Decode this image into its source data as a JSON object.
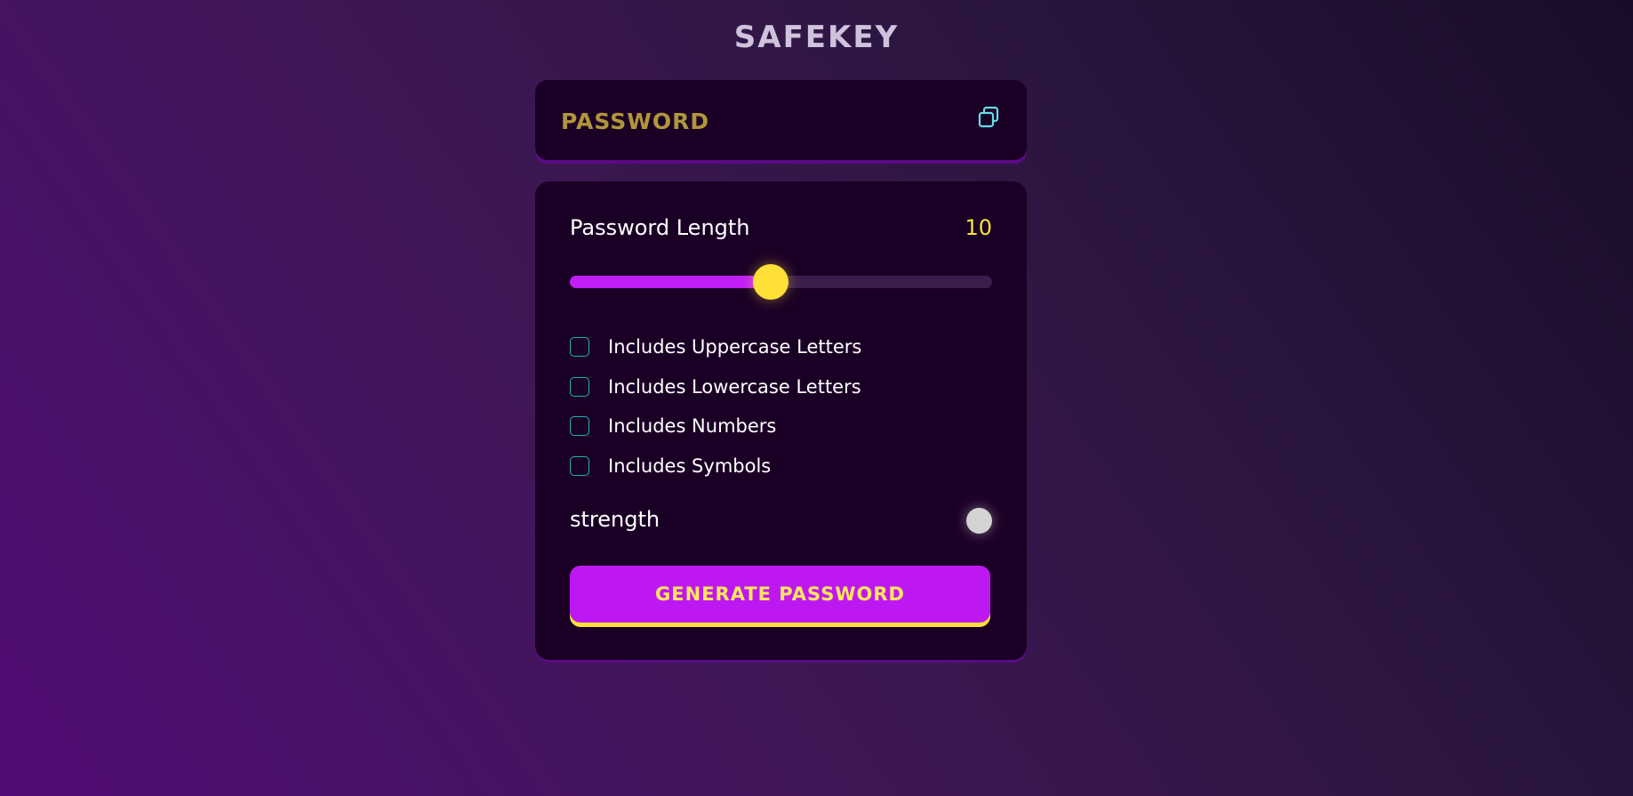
{
  "app": {
    "title": "SAFEKEY"
  },
  "password_display": {
    "value": "PASSWORD",
    "copy_icon": "copy-icon"
  },
  "length": {
    "label": "Password Length",
    "value": "10",
    "slider_fraction": 0.475
  },
  "options": [
    {
      "label": "Includes Uppercase Letters",
      "checked": false
    },
    {
      "label": "Includes Lowercase Letters",
      "checked": false
    },
    {
      "label": "Includes Numbers",
      "checked": false
    },
    {
      "label": "Includes Symbols",
      "checked": false
    }
  ],
  "strength": {
    "label": "strength"
  },
  "generate": {
    "label": "GENERATE PASSWORD"
  },
  "colors": {
    "accent_purple": "#be18f2",
    "accent_yellow": "#ffe037",
    "checkbox_teal": "#1fb5b2",
    "password_text": "#b0963b",
    "panel_bg": "#1b0026"
  }
}
